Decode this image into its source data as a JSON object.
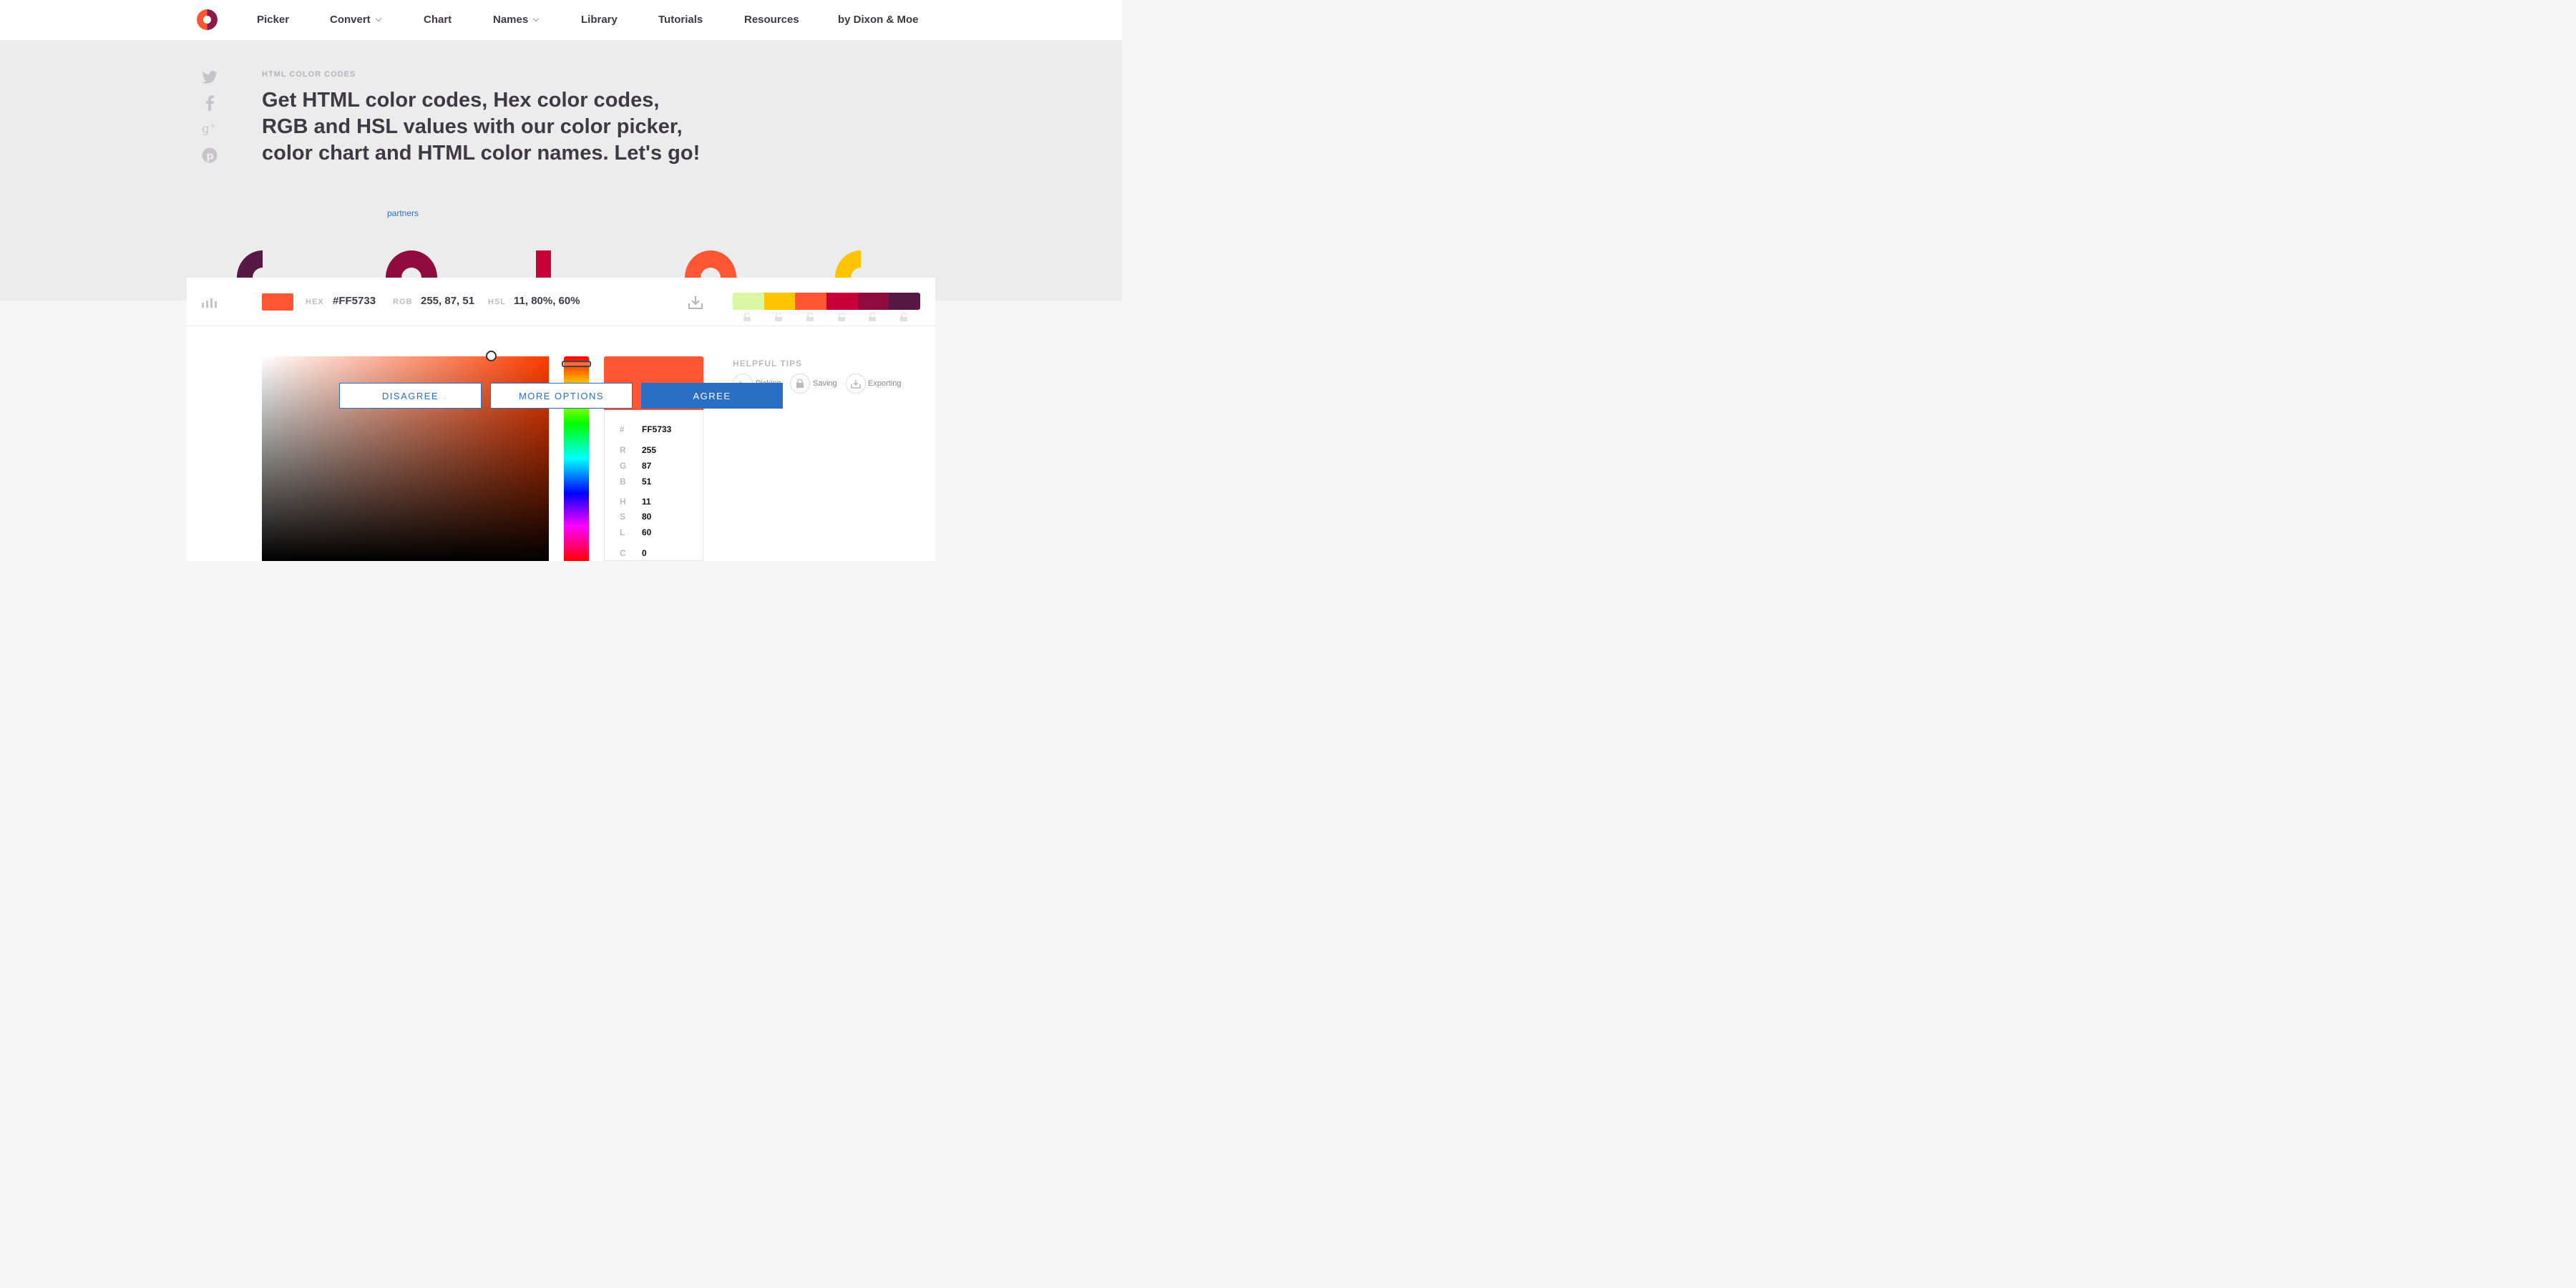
{
  "nav": {
    "items": [
      {
        "label": "Picker"
      },
      {
        "label": "Convert",
        "dropdown": true
      },
      {
        "label": "Chart"
      },
      {
        "label": "Names",
        "dropdown": true
      },
      {
        "label": "Library"
      },
      {
        "label": "Tutorials"
      },
      {
        "label": "Resources"
      },
      {
        "label": "by Dixon & Moe"
      }
    ]
  },
  "social_icons": [
    "twitter-icon",
    "facebook-icon",
    "google-plus-icon",
    "pinterest-icon"
  ],
  "hero": {
    "eyebrow": "HTML COLOR CODES",
    "headline": "Get HTML color codes, Hex color codes, RGB and HSL values with our color picker, color chart and HTML color names. Let's go!",
    "partners_link": "partners"
  },
  "color_bar": {
    "swatch_color": "#FF5733",
    "hex_label": "HEX",
    "hex_value": "#FF5733",
    "rgb_label": "RGB",
    "rgb_value": "255, 87, 51",
    "hsl_label": "HSL",
    "hsl_value": "11, 80%, 60%",
    "palette": [
      "#DAF7A6",
      "#FFC300",
      "#FF5733",
      "#C70039",
      "#900C3F",
      "#581845"
    ]
  },
  "picker": {
    "hex_label": "#",
    "hex": "FF5733",
    "r_label": "R",
    "r": "255",
    "g_label": "G",
    "g": "87",
    "b_label": "B",
    "b": "51",
    "h_label": "H",
    "h": "11",
    "s_label": "S",
    "s": "80",
    "l_label": "L",
    "l": "60",
    "c_label": "C",
    "c": "0"
  },
  "tips": {
    "title": "HELPFUL TIPS",
    "items": [
      "Picking",
      "Saving",
      "Exporting"
    ]
  },
  "consent": {
    "disagree": "DISAGREE",
    "more_options": "MORE OPTIONS",
    "agree": "AGREE"
  }
}
